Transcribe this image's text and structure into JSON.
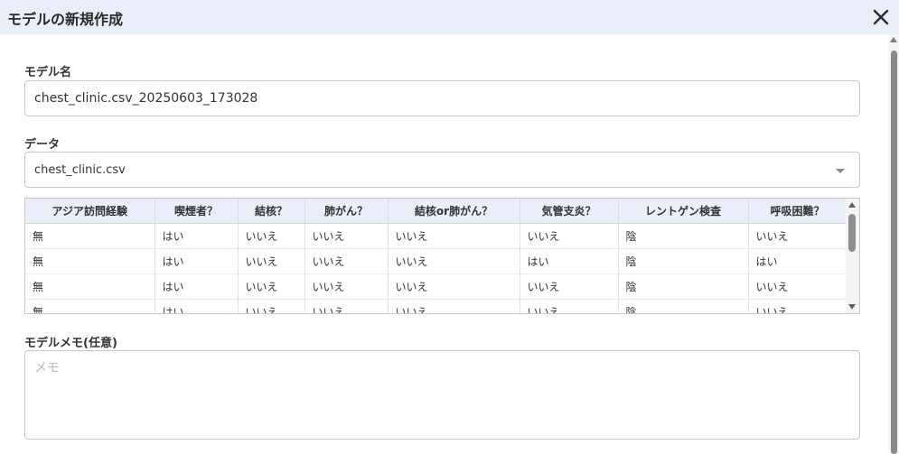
{
  "dialog": {
    "title": "モデルの新規作成",
    "close_icon": "close-icon"
  },
  "model_name": {
    "label": "モデル名",
    "value": "chest_clinic.csv_20250603_173028"
  },
  "data_select": {
    "label": "データ",
    "selected": "chest_clinic.csv"
  },
  "preview_table": {
    "columns": [
      "アジア訪問経験",
      "喫煙者？",
      "結核？",
      "肺がん？",
      "結核or肺がん？",
      "気管支炎？",
      "レントゲン検査",
      "呼吸困難？"
    ],
    "rows": [
      [
        "無",
        "はい",
        "いいえ",
        "いいえ",
        "いいえ",
        "いいえ",
        "陰",
        "いいえ"
      ],
      [
        "無",
        "はい",
        "いいえ",
        "いいえ",
        "いいえ",
        "はい",
        "陰",
        "はい"
      ],
      [
        "無",
        "はい",
        "いいえ",
        "いいえ",
        "いいえ",
        "いいえ",
        "陰",
        "いいえ"
      ],
      [
        "無",
        "はい",
        "いいえ",
        "いいえ",
        "いいえ",
        "いいえ",
        "陰",
        "いいえ"
      ]
    ]
  },
  "memo": {
    "label": "モデルメモ(任意)",
    "placeholder": "メモ"
  },
  "colors": {
    "header_bg": "#e9eef8",
    "border": "#c9c9c9"
  }
}
